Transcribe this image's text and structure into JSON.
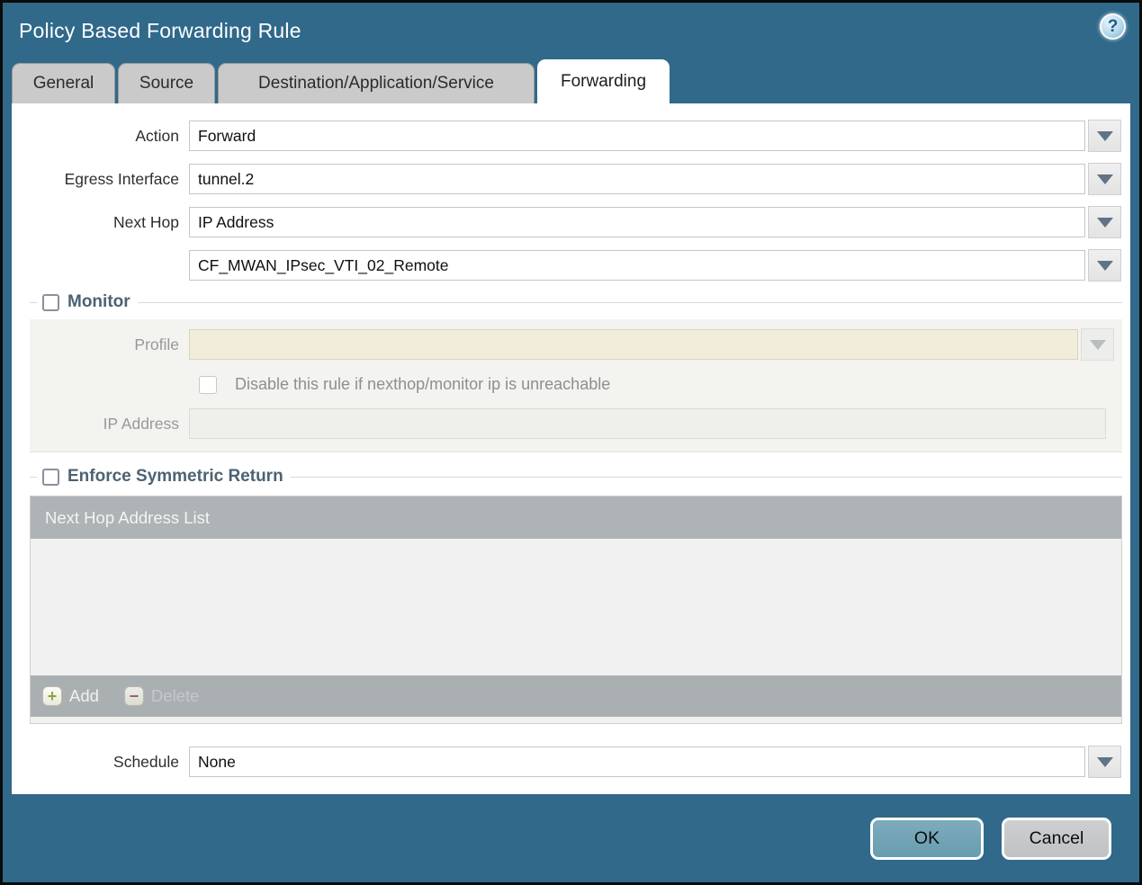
{
  "dialog": {
    "title": "Policy Based Forwarding Rule"
  },
  "icons": {
    "help_glyph": "?",
    "add_glyph": "+",
    "delete_glyph": "−"
  },
  "tabs": [
    {
      "label": "General",
      "active": false
    },
    {
      "label": "Source",
      "active": false
    },
    {
      "label": "Destination/Application/Service",
      "active": false
    },
    {
      "label": "Forwarding",
      "active": true
    }
  ],
  "form": {
    "action": {
      "label": "Action",
      "value": "Forward"
    },
    "egress_interface": {
      "label": "Egress Interface",
      "value": "tunnel.2"
    },
    "next_hop": {
      "label": "Next Hop",
      "value": "IP Address"
    },
    "next_hop_address": {
      "value": "CF_MWAN_IPsec_VTI_02_Remote"
    },
    "schedule": {
      "label": "Schedule",
      "value": "None"
    }
  },
  "monitor": {
    "legend": "Monitor",
    "checked": false,
    "profile": {
      "label": "Profile",
      "value": ""
    },
    "disable_rule_checkbox": {
      "label": "Disable this rule if nexthop/monitor ip is unreachable",
      "checked": false
    },
    "ip_address": {
      "label": "IP Address",
      "value": ""
    }
  },
  "enforce_symmetric_return": {
    "legend": "Enforce Symmetric Return",
    "checked": false,
    "table": {
      "header": "Next Hop Address List",
      "rows": []
    },
    "add_label": "Add",
    "delete_label": "Delete"
  },
  "footer": {
    "ok_label": "OK",
    "cancel_label": "Cancel"
  },
  "colors": {
    "titlebar_teal": "#30698a",
    "tab_gray": "#c9cac9",
    "table_header_gray": "#aeb3b6",
    "disabled_field_beige": "#f2edda",
    "ok_button_teal": "#6ca2b4",
    "legend_text": "#4d6272"
  }
}
